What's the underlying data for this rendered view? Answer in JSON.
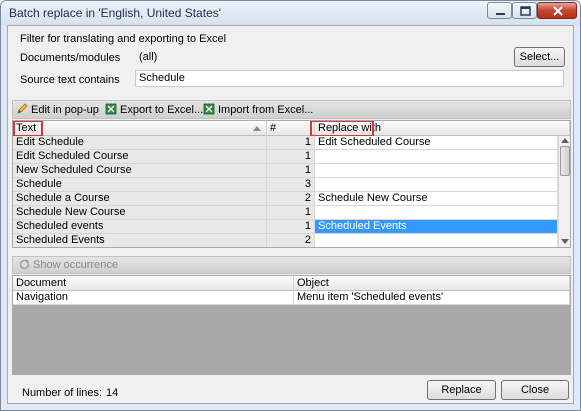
{
  "window": {
    "title": "Batch replace in 'English, United States'"
  },
  "filter": {
    "group_label": "Filter for translating and exporting to Excel",
    "documents_label": "Documents/modules",
    "documents_value": "(all)",
    "select_button": "Select...",
    "source_label": "Source text contains",
    "source_value": "Schedule"
  },
  "toolbar": {
    "edit_popup": "Edit in pop-up",
    "export_excel": "Export to Excel...",
    "import_excel": "Import from Excel..."
  },
  "grid": {
    "columns": {
      "text": "Text",
      "count": "#",
      "replace": "Replace with"
    },
    "rows": [
      {
        "text": "Edit Schedule",
        "count": "1",
        "replace": "Edit Scheduled Course",
        "selected": false
      },
      {
        "text": "Edit Scheduled Course",
        "count": "1",
        "replace": "",
        "selected": false
      },
      {
        "text": "New Scheduled Course",
        "count": "1",
        "replace": "",
        "selected": false
      },
      {
        "text": "Schedule",
        "count": "3",
        "replace": "",
        "selected": false
      },
      {
        "text": "Schedule a Course",
        "count": "2",
        "replace": "Schedule New Course",
        "selected": false
      },
      {
        "text": "Schedule New Course",
        "count": "1",
        "replace": "",
        "selected": false
      },
      {
        "text": "Scheduled events",
        "count": "1",
        "replace": "Scheduled Events",
        "selected": true
      },
      {
        "text": "Scheduled Events",
        "count": "2",
        "replace": "",
        "selected": false
      }
    ]
  },
  "occurrence": {
    "show_label": "Show occurrence",
    "columns": {
      "document": "Document",
      "object": "Object"
    },
    "rows": [
      {
        "document": "Navigation",
        "object": "Menu item 'Scheduled events'"
      }
    ]
  },
  "footer": {
    "lines_label": "Number of lines:",
    "lines_value": "14",
    "replace_button": "Replace",
    "close_button": "Close"
  },
  "colors": {
    "selection": "#3399ff",
    "highlight_box": "#d9343b"
  }
}
